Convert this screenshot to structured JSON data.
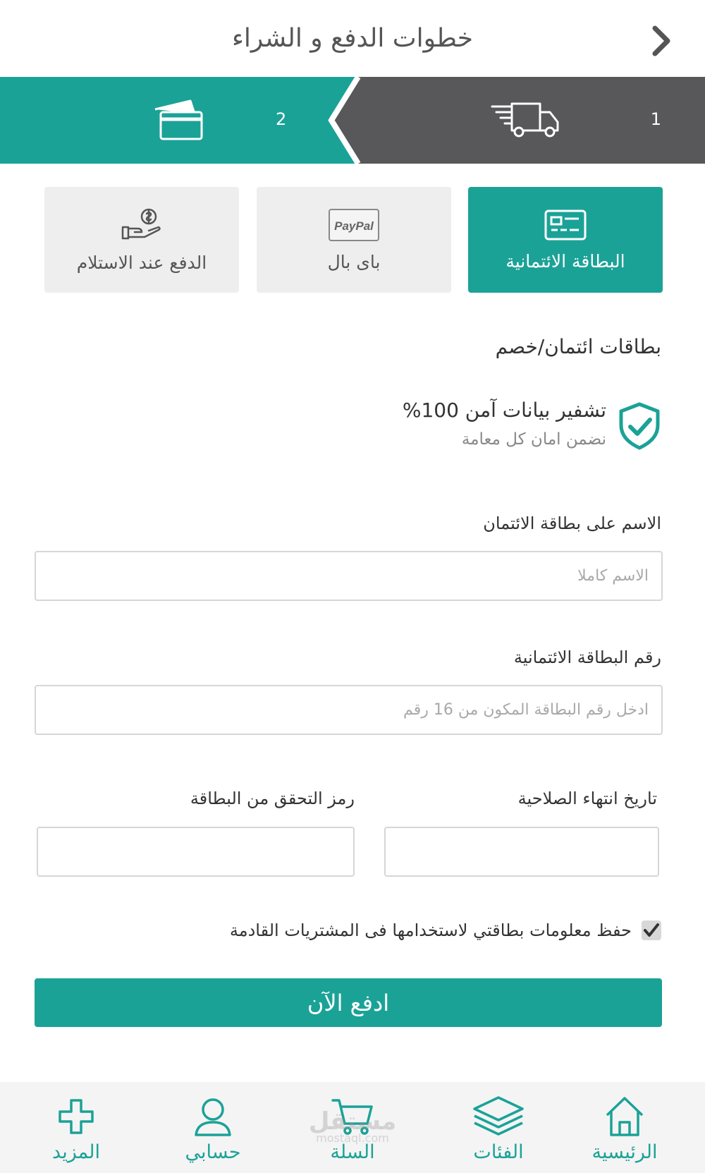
{
  "header": {
    "title": "خطوات الدفع و الشراء"
  },
  "steps": [
    {
      "number": "1",
      "icon": "delivery-truck-icon"
    },
    {
      "number": "2",
      "icon": "credit-cards-icon"
    }
  ],
  "payment_methods": [
    {
      "label": "البطاقة الائتمانية",
      "icon": "credit-card-icon",
      "active": true
    },
    {
      "label": "باى بال",
      "icon": "paypal-icon",
      "icon_text": "PayPal",
      "active": false
    },
    {
      "label": "الدفع عند الاستلام",
      "icon": "cash-on-delivery-icon",
      "active": false
    }
  ],
  "section_title": "بطاقات ائتمان/خصم",
  "security": {
    "title": "تشفير بيانات آمن 100%",
    "subtitle": "نضمن امان كل معامة"
  },
  "form": {
    "name_label": "الاسم على بطاقة الائتمان",
    "name_placeholder": "الاسم كاملا",
    "number_label": "رقم البطاقة الائتمانية",
    "number_placeholder": "ادخل رقم البطاقة المكون من 16 رقم",
    "expiry_label": "تاريخ انتهاء الصلاحية",
    "cvv_label": "رمز التحقق من البطاقة",
    "save_card_label": "حفظ معلومات بطاقتي لاستخدامها فى المشتريات القادمة",
    "save_card_checked": true,
    "pay_button": "ادفع الآن"
  },
  "bottom_nav": [
    {
      "label": "الرئيسية",
      "icon": "home-icon"
    },
    {
      "label": "الفئات",
      "icon": "layers-icon"
    },
    {
      "label": "السلة",
      "icon": "cart-icon"
    },
    {
      "label": "حسابي",
      "icon": "user-icon"
    },
    {
      "label": "المزيد",
      "icon": "plus-icon"
    }
  ],
  "watermark": {
    "arabic": "مستقل",
    "latin": "mostaql.com"
  },
  "colors": {
    "accent": "#1ba297",
    "dark_step": "#58585a",
    "inactive_tab": "#eeeeee"
  }
}
